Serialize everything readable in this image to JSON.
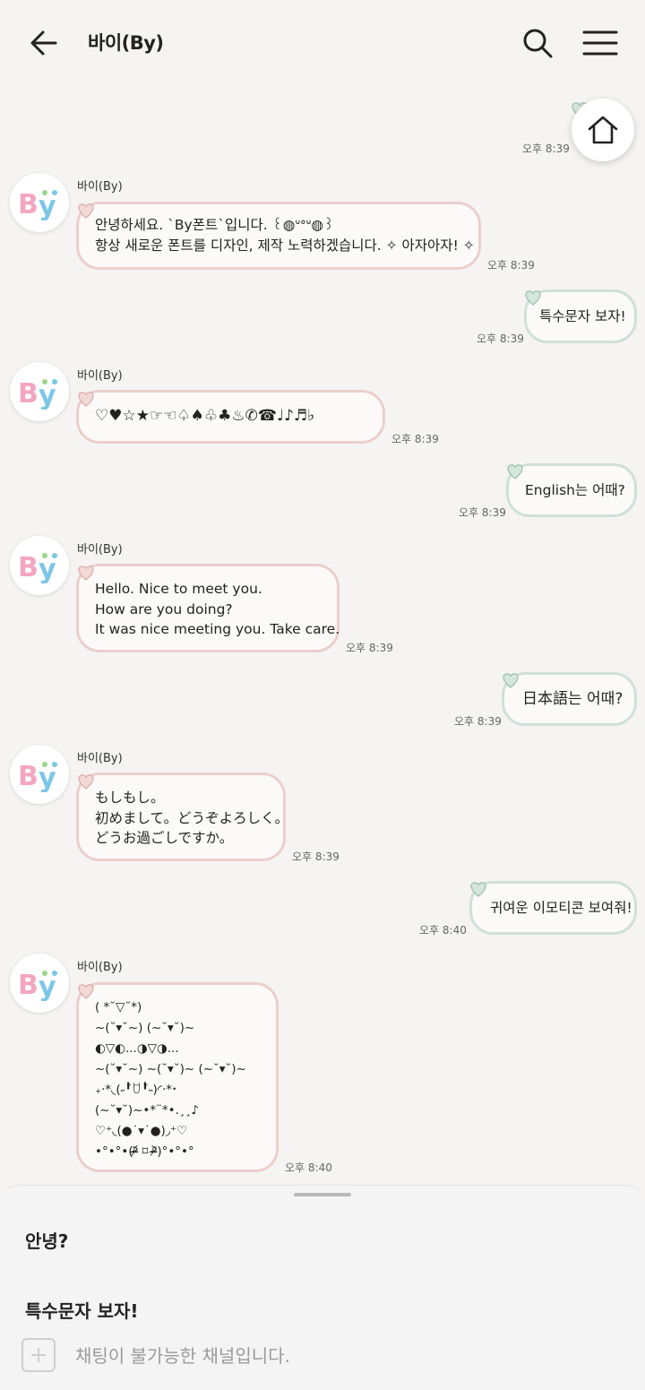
{
  "header": {
    "title": "바이(By)",
    "back_icon": "arrow-left-icon",
    "search_icon": "search-icon",
    "menu_icon": "hamburger-menu-icon"
  },
  "home_icon": "home-icon",
  "colors": {
    "incoming_border": "#ebcfcc",
    "outgoing_border": "#cfe0d7",
    "background": "#f5f4f2"
  },
  "messages": [
    {
      "dir": "out",
      "time": "오후 8:39"
    },
    {
      "dir": "in",
      "sender": "바이(By)",
      "lines": [
        "안녕하세요. `By폰트`입니다. ꒰◍ᐡᐤᐡ◍꒱",
        "항상 새로운 폰트를 디자인, 제작 노력하겠습니다. ✧ 아자아자! ✧"
      ],
      "time": "오후 8:39"
    },
    {
      "dir": "out",
      "lines": [
        "특수문자 보자!"
      ],
      "time": "오후 8:39"
    },
    {
      "dir": "in",
      "sender": "바이(By)",
      "lines": [
        "♡♥☆★☞☜♤♠♧♣♨✆☎♩♪♬♭"
      ],
      "time": "오후 8:39"
    },
    {
      "dir": "out",
      "lines": [
        "English는 어때?"
      ],
      "time": "오후 8:39"
    },
    {
      "dir": "in",
      "sender": "바이(By)",
      "lines": [
        "Hello. Nice to meet you.",
        "How are you doing?",
        "It was nice meeting you. Take care."
      ],
      "time": "오후 8:39"
    },
    {
      "dir": "out",
      "lines": [
        "日本語는 어때?"
      ],
      "time": "오후 8:39"
    },
    {
      "dir": "in",
      "sender": "바이(By)",
      "lines": [
        "もしもし。",
        "初めまして。どうぞよろしく。",
        "どうお過ごしですか。"
      ],
      "time": "오후 8:39"
    },
    {
      "dir": "out",
      "lines": [
        "귀여운 이모티콘 보여줘!"
      ],
      "time": "오후 8:40"
    },
    {
      "dir": "in",
      "sender": "바이(By)",
      "lines": [
        "( *˘▽˘*)",
        "~(˘▾˘~) (~˘▾˘)~",
        "◐▽◐...◑▽◑...",
        "~(˘▾˘~) ~(˘▾˘)~ (~˘▾˘)~",
        "₊·*◟(˶╹̆ꇴ╹̆˵)◜‧*･",
        "(~˘▾˘)~•*¨*•.¸¸♪",
        "♡⁺◟(●˙▾˙●)◞⁺♡",
        "•°•°•(ᵒ̴̶̷᷄ ⌑ ᵒ̴̶̷᷅)°•°•°"
      ],
      "time": "오후 8:40"
    }
  ],
  "sheet": {
    "quick_replies": [
      "안녕?",
      "특수문자 보자!"
    ],
    "plus_icon": "plus-icon",
    "disabled_text": "채팅이 불가능한 채널입니다."
  }
}
